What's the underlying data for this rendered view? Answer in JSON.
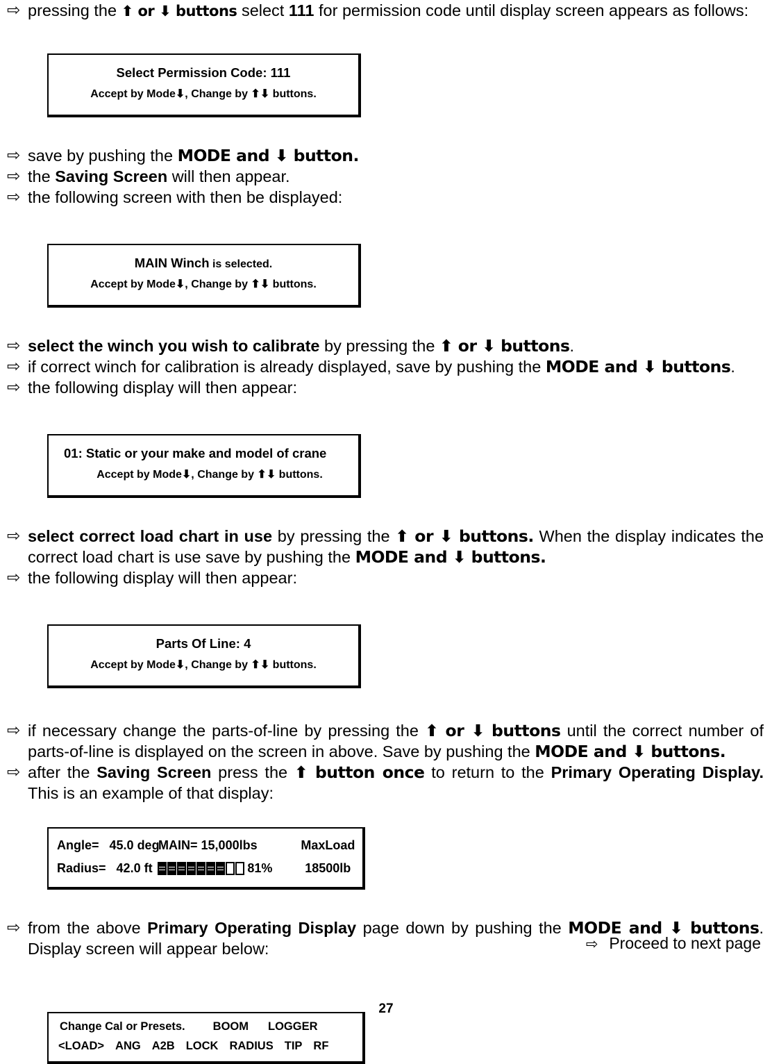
{
  "document": {
    "page_number": "27",
    "next_page_note": "Proceed to next page",
    "bullet_glyph": "⇨",
    "up_arrow": "⬆",
    "down_arrow": "⬇"
  },
  "steps": {
    "s1": {
      "t1": "pressing the ",
      "b1": "⬆ or ⬇ buttons",
      "t2": " select ",
      "b2": "111",
      "t3": " for permission code until display screen appears as follows:"
    },
    "s2": {
      "t1": "save by pushing the ",
      "b1": "MODE and ⬇ button."
    },
    "s3": {
      "t1": "the ",
      "b1": "Saving Screen",
      "t2": " will then appear."
    },
    "s4": {
      "t1": "the following screen with then be displayed:"
    },
    "s5": {
      "b1": "select the winch you wish to calibrate",
      "t1": " by pressing the ",
      "b2": "⬆ or ⬇ buttons",
      "t2": "."
    },
    "s6": {
      "t1": "if correct winch for calibration is already displayed, save by pushing the ",
      "b1": "MODE and ⬇ buttons",
      "t2": "."
    },
    "s7": {
      "t1": "the following display will then appear:"
    },
    "s8": {
      "b1": "select correct load chart in use",
      "t1": " by pressing the ",
      "b2": "⬆ or ⬇ buttons.",
      "t2": "  When the display indicates the correct load chart is use save by pushing the ",
      "b3": "MODE and ⬇ buttons."
    },
    "s9": {
      "t1": "the following display will then appear:"
    },
    "s10": {
      "t1": "if necessary change the parts-of-line by pressing the ",
      "b1": "⬆ or ⬇ buttons",
      "t2": " until the correct number of parts-of-line is displayed on the screen in above.  Save by pushing the ",
      "b2": "MODE and ⬇ buttons."
    },
    "s11": {
      "t1": "after the ",
      "b1": "Saving Screen",
      "t2": " press the ",
      "b2": "⬆ button once",
      "t3": " to  return to the ",
      "b3": "Primary Operating Display.",
      "t4": " This is an example of that display:"
    },
    "s12": {
      "t1": "from the above ",
      "b1": "Primary Operating Display",
      "t2": " page down by pushing the ",
      "b2": "MODE and ⬇ buttons",
      "t3": ". Display screen will appear below:"
    }
  },
  "screens": {
    "permission": {
      "line1": "Select Permission Code:  111",
      "line2": "Accept by Mode⬇, Change by ⬆⬇ buttons."
    },
    "winch": {
      "line1_bold": "MAIN Winch",
      "line1_small": " is selected.",
      "line2": "Accept by Mode⬇, Change by ⬆⬇ buttons."
    },
    "loadchart": {
      "line1": "01:    Static or your make and model of crane",
      "line2": "Accept by Mode⬇, Change by ⬆⬇ buttons."
    },
    "partsofline": {
      "line1": "Parts Of Line:   4",
      "line2": "Accept by Mode⬇, Change by ⬆⬇ buttons."
    },
    "primary_operating_display": {
      "angle_label": "Angle=",
      "angle_value": "45.0 deg",
      "radius_label": "Radius=",
      "radius_value": "42.0 ft",
      "winch_label": "MAIN=",
      "winch_value": "15,000lbs",
      "percent": "81%",
      "maxload_label": "MaxLoad",
      "maxload_value": "18500lb",
      "bargraph_total": 9,
      "bargraph_filled": 7
    },
    "menu": {
      "line1_a": "Change Cal or Presets.",
      "line1_b": "BOOM",
      "line1_c": "LOGGER",
      "items": [
        "<LOAD>",
        "ANG",
        "A2B",
        "LOCK",
        "RADIUS",
        "TIP",
        "RF"
      ]
    }
  }
}
